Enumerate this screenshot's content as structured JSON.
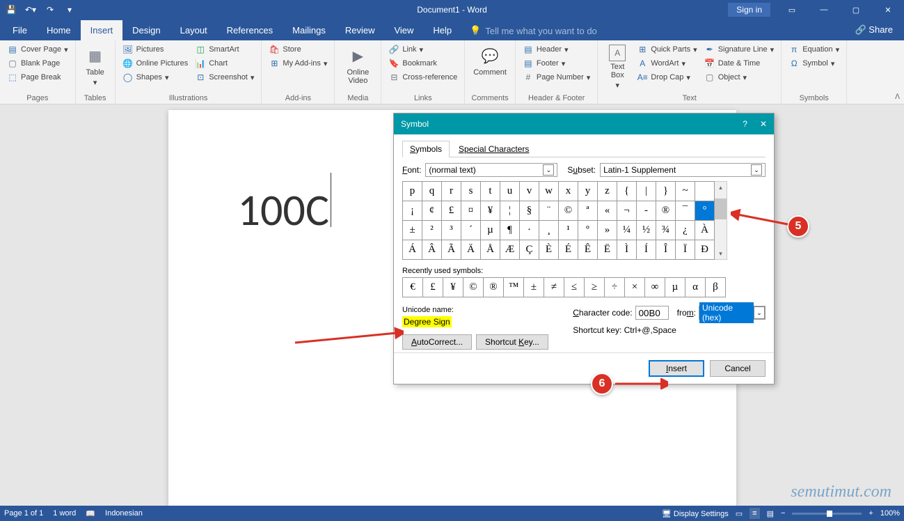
{
  "titlebar": {
    "title": "Document1 - Word",
    "signin": "Sign in"
  },
  "tabs": [
    "File",
    "Home",
    "Insert",
    "Design",
    "Layout",
    "References",
    "Mailings",
    "Review",
    "View",
    "Help"
  ],
  "active_tab": "Insert",
  "tellme": "Tell me what you want to do",
  "share": "Share",
  "ribbon": {
    "pages": {
      "label": "Pages",
      "items": [
        "Cover Page",
        "Blank Page",
        "Page Break"
      ]
    },
    "tables": {
      "label": "Tables",
      "btn": "Table"
    },
    "illustrations": {
      "label": "Illustrations",
      "col1": [
        "Pictures",
        "Online Pictures",
        "Shapes"
      ],
      "col2": [
        "SmartArt",
        "Chart",
        "Screenshot"
      ]
    },
    "addins": {
      "label": "Add-ins",
      "items": [
        "Store",
        "My Add-ins"
      ]
    },
    "media": {
      "label": "Media",
      "btn": "Online Video"
    },
    "links": {
      "label": "Links",
      "items": [
        "Link",
        "Bookmark",
        "Cross-reference"
      ]
    },
    "comments": {
      "label": "Comments",
      "btn": "Comment"
    },
    "headerfooter": {
      "label": "Header & Footer",
      "items": [
        "Header",
        "Footer",
        "Page Number"
      ]
    },
    "text": {
      "label": "Text",
      "btn": "Text Box",
      "col1": [
        "Quick Parts",
        "WordArt",
        "Drop Cap"
      ],
      "col2": [
        "Signature Line",
        "Date & Time",
        "Object"
      ]
    },
    "symbols": {
      "label": "Symbols",
      "items": [
        "Equation",
        "Symbol"
      ]
    }
  },
  "document": {
    "text": "100C"
  },
  "dialog": {
    "title": "Symbol",
    "tabs": [
      "Symbols",
      "Special Characters"
    ],
    "active_tab": "Symbols",
    "font_label": "Font:",
    "font_value": "(normal text)",
    "subset_label": "Subset:",
    "subset_value": "Latin-1 Supplement",
    "grid": [
      [
        "p",
        "q",
        "r",
        "s",
        "t",
        "u",
        "v",
        "w",
        "x",
        "y",
        "z",
        "{",
        "|",
        "}",
        "~",
        ""
      ],
      [
        "¡",
        "¢",
        "£",
        "¤",
        "¥",
        "¦",
        "§",
        "¨",
        "©",
        "ª",
        "«",
        "¬",
        "-",
        "®",
        "¯",
        "°"
      ],
      [
        "±",
        "²",
        "³",
        "´",
        "µ",
        "¶",
        "·",
        "¸",
        "¹",
        "º",
        "»",
        "¼",
        "½",
        "¾",
        "¿",
        "À"
      ],
      [
        "Á",
        "Â",
        "Ã",
        "Ä",
        "Å",
        "Æ",
        "Ç",
        "È",
        "É",
        "Ê",
        "Ë",
        "Ì",
        "Í",
        "Î",
        "Ï",
        "Ð"
      ]
    ],
    "selected_index": [
      1,
      15
    ],
    "recent_label": "Recently used symbols:",
    "recent": [
      "€",
      "£",
      "¥",
      "©",
      "®",
      "™",
      "±",
      "≠",
      "≤",
      "≥",
      "÷",
      "×",
      "∞",
      "µ",
      "α",
      "β"
    ],
    "unicode_name_label": "Unicode name:",
    "unicode_name": "Degree Sign",
    "char_code_label": "Character code:",
    "char_code": "00B0",
    "from_label": "from:",
    "from_value": "Unicode (hex)",
    "autocorrect": "AutoCorrect...",
    "shortcut_key": "Shortcut Key...",
    "shortcut_info": "Shortcut key: Ctrl+@,Space",
    "insert": "Insert",
    "cancel": "Cancel"
  },
  "status": {
    "page": "Page 1 of 1",
    "words": "1 word",
    "lang": "Indonesian",
    "display": "Display Settings",
    "zoom": "100%"
  },
  "callouts": {
    "c5": "5",
    "c6": "6"
  },
  "watermark": "semutimut.com"
}
